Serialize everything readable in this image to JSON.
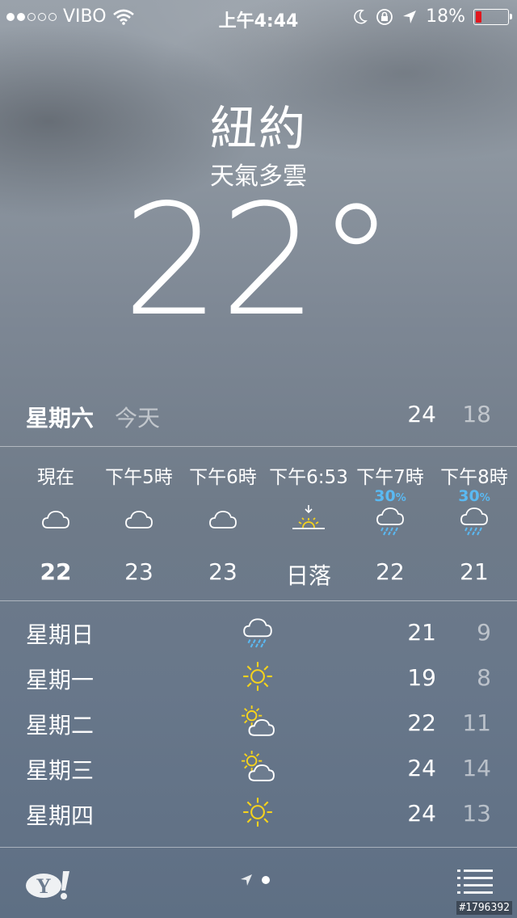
{
  "status_bar": {
    "signal_dots": [
      true,
      true,
      false,
      false,
      false
    ],
    "carrier": "VIBO",
    "time": "上午4:44",
    "battery": "18%",
    "battery_level": 0.18,
    "battery_color": "#e1171e"
  },
  "location": {
    "city": "紐約",
    "condition": "天氣多雲",
    "temperature": "22°"
  },
  "today": {
    "day": "星期六",
    "label": "今天",
    "high": "24",
    "low": "18"
  },
  "hourly": [
    {
      "time": "現在",
      "icon": "cloud-icon",
      "precip": "",
      "temp": "22",
      "bold": true
    },
    {
      "time": "下午5時",
      "icon": "cloud-icon",
      "precip": "",
      "temp": "23"
    },
    {
      "time": "下午6時",
      "icon": "cloud-icon",
      "precip": "",
      "temp": "23"
    },
    {
      "time": "下午6:53",
      "icon": "sunset-icon",
      "precip": "",
      "temp": "日落"
    },
    {
      "time": "下午7時",
      "icon": "rain-cloud-icon",
      "precip": "30",
      "precip_unit": "%",
      "temp": "22"
    },
    {
      "time": "下午8時",
      "icon": "rain-cloud-icon",
      "precip": "30",
      "precip_unit": "%",
      "temp": "21"
    }
  ],
  "daily": [
    {
      "day": "星期日",
      "icon": "rain-cloud-icon",
      "high": "21",
      "low": "9"
    },
    {
      "day": "星期一",
      "icon": "sun-icon",
      "high": "19",
      "low": "8"
    },
    {
      "day": "星期二",
      "icon": "partly-cloudy-icon",
      "high": "22",
      "low": "11"
    },
    {
      "day": "星期三",
      "icon": "partly-cloudy-icon",
      "high": "24",
      "low": "14"
    },
    {
      "day": "星期四",
      "icon": "sun-icon",
      "high": "24",
      "low": "13"
    }
  ],
  "footer": {
    "logo": "Y!",
    "watermark": "#1796392"
  },
  "colors": {
    "precip": "#5ab9f2",
    "sun": "#f6d31c",
    "rain": "#5ab9f2"
  }
}
